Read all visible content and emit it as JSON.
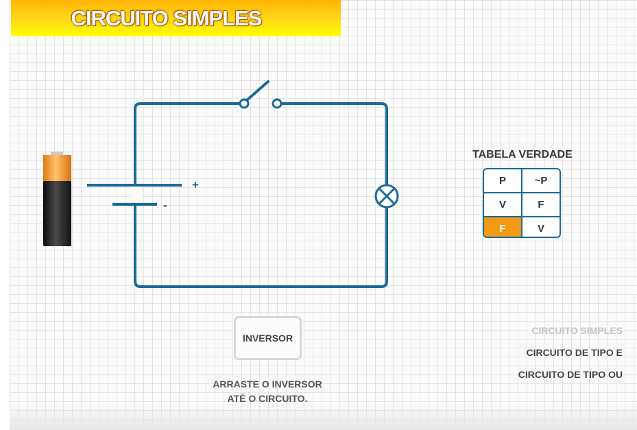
{
  "title": "CIRCUITO SIMPLES",
  "battery": {
    "plus_label": "+",
    "minus_label": "-"
  },
  "truth_table": {
    "title": "TABELA VERDADE",
    "headers": [
      "P",
      "~P"
    ],
    "rows": [
      [
        "V",
        "F"
      ],
      [
        "F",
        "V"
      ]
    ],
    "highlighted_cell": "F"
  },
  "inversor": {
    "label": "INVERSOR",
    "instruction_line1": "ARRASTE O INVERSOR",
    "instruction_line2": "ATÉ O CIRCUITO."
  },
  "menu": {
    "items": [
      {
        "label": "CIRCUITO SIMPLES",
        "state": "current"
      },
      {
        "label": "CIRCUITO DE TIPO E",
        "state": "available"
      },
      {
        "label": "CIRCUITO DE TIPO OU",
        "state": "available"
      }
    ]
  },
  "colors": {
    "wire": "#1a6a9a",
    "title_gradient_top": "#ffb400",
    "title_gradient_bottom": "#ffff00",
    "highlight": "#f39a14",
    "battery_cap": "#f7a02a"
  }
}
